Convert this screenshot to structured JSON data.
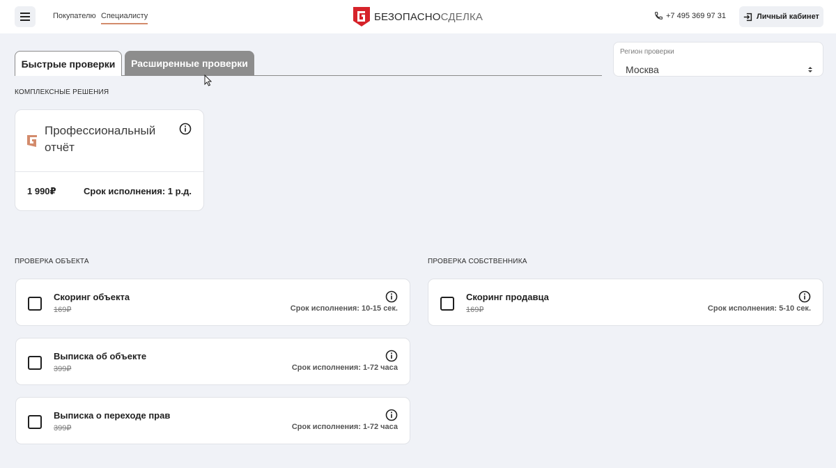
{
  "header": {
    "nav": {
      "buyer": "Покупателю",
      "specialist": "Специалисту"
    },
    "logo": {
      "strong": "БЕЗОПАСНО",
      "light": "СДЕЛКА"
    },
    "phone": "+7 495 369 97 31",
    "cabinet": "Личный кабинет"
  },
  "tabs": {
    "quick": "Быстрые проверки",
    "extended": "Расширенные проверки"
  },
  "region": {
    "label": "Регион проверки",
    "value": "Москва"
  },
  "sections": {
    "complex": "КОМПЛЕКСНЫЕ РЕШЕНИЯ",
    "object": "ПРОВЕРКА ОБЪЕКТА",
    "owner": "ПРОВЕРКА СОБСТВЕННИКА"
  },
  "pro_report": {
    "title": "Профессиональный отчёт",
    "price": "1 990₽",
    "term": "Срок исполнения: 1 р.д."
  },
  "object_checks": [
    {
      "name": "Скоринг объекта",
      "price": "169₽",
      "term": "Срок исполнения: 10-15 сек."
    },
    {
      "name": "Выписка об объекте",
      "price": "399₽",
      "term": "Срок исполнения: 1-72 часа"
    },
    {
      "name": "Выписка о переходе прав",
      "price": "399₽",
      "term": "Срок исполнения: 1-72 часа"
    }
  ],
  "owner_checks": [
    {
      "name": "Скоринг продавца",
      "price": "169₽",
      "term": "Срок исполнения: 5-10 сек."
    }
  ],
  "colors": {
    "brand": "#d6232a",
    "accent": "#d38b6c",
    "tab_inactive": "#8d8d8d",
    "background": "#f0f2f7"
  },
  "icons": [
    "menu-icon",
    "logo-shield-icon",
    "phone-icon",
    "login-icon",
    "info-icon",
    "select-arrows-icon",
    "mouse-cursor-icon"
  ]
}
